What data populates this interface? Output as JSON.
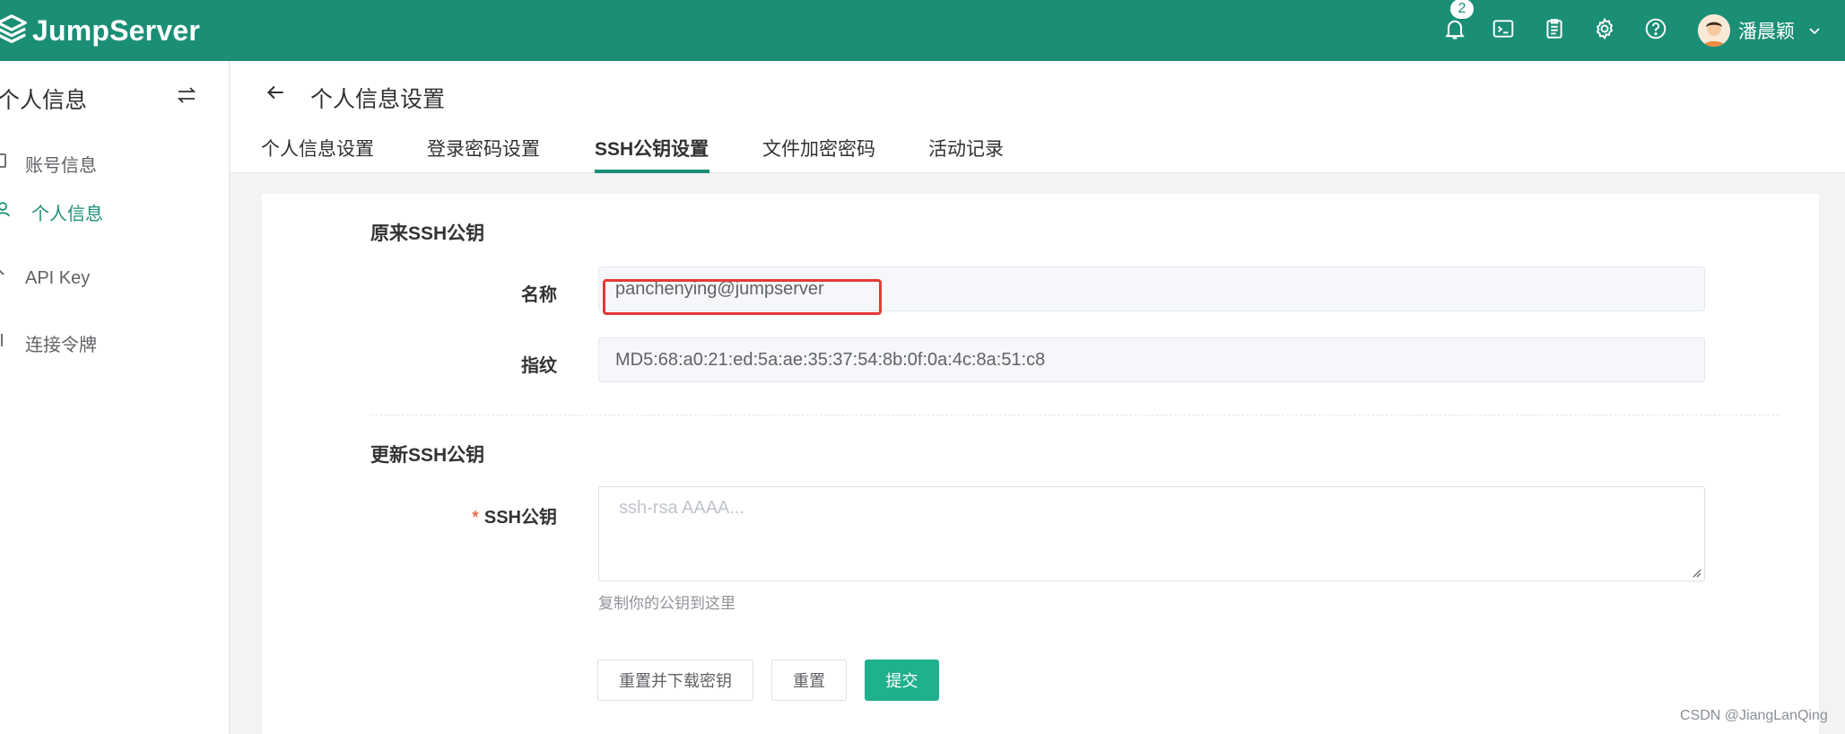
{
  "app": {
    "name": "JumpServer",
    "brand_color": "#1b8e76",
    "accent": "#1fb08e"
  },
  "topbar": {
    "notification_count": "2",
    "icons": [
      "bell-icon",
      "terminal-icon",
      "clipboard-icon",
      "gear-icon",
      "help-icon"
    ],
    "user_name": "潘晨颖"
  },
  "sidebar": {
    "title": "个人信息",
    "items": [
      {
        "label": "账号信息",
        "icon": "account-icon",
        "active": false
      },
      {
        "label": "个人信息",
        "icon": "user-icon",
        "active": true
      },
      {
        "label": "API Key",
        "icon": "key-icon",
        "active": false
      },
      {
        "label": "连接令牌",
        "icon": "token-icon",
        "active": false
      }
    ]
  },
  "header": {
    "title": "个人信息设置",
    "tabs": [
      {
        "label": "个人信息设置"
      },
      {
        "label": "登录密码设置"
      },
      {
        "label": "SSH公钥设置",
        "active": true
      },
      {
        "label": "文件加密密码"
      },
      {
        "label": "活动记录"
      }
    ]
  },
  "form": {
    "original_section": "原来SSH公钥",
    "name_label": "名称",
    "name_value": "panchenying@jumpserver",
    "fingerprint_label": "指纹",
    "fingerprint_value": "MD5:68:a0:21:ed:5a:ae:35:37:54:8b:0f:0a:4c:8a:51:c8",
    "update_section": "更新SSH公钥",
    "required_mark": "*",
    "ssh_label": "SSH公钥",
    "ssh_placeholder": "ssh-rsa AAAA...",
    "ssh_help": "复制你的公钥到这里",
    "buttons": {
      "reset_download": "重置并下载密钥",
      "reset": "重置",
      "submit": "提交"
    }
  },
  "watermark": "CSDN @JiangLanQing"
}
